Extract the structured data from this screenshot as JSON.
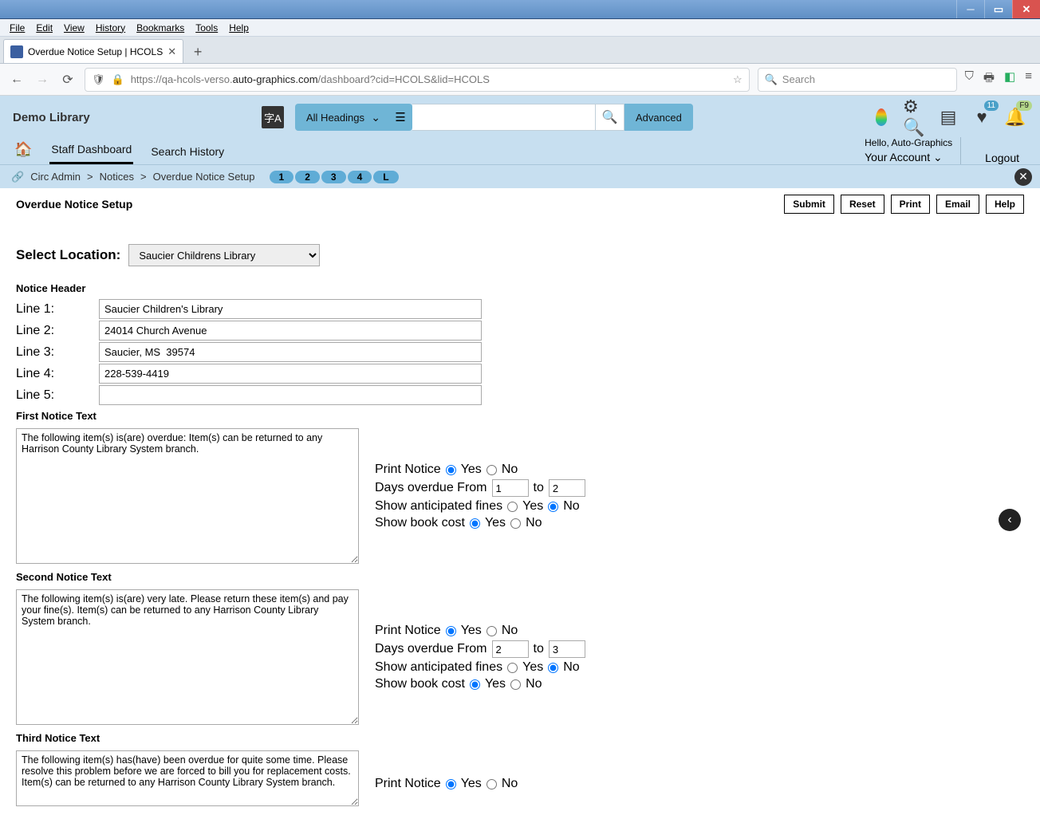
{
  "browser_menu": [
    "File",
    "Edit",
    "View",
    "History",
    "Bookmarks",
    "Tools",
    "Help"
  ],
  "tab_title": "Overdue Notice Setup | HCOLS",
  "url": {
    "prefix": "https://qa-hcols-verso.",
    "domain": "auto-graphics.com",
    "suffix": "/dashboard?cid=HCOLS&lid=HCOLS"
  },
  "search_placeholder": "Search",
  "app": {
    "library_name": "Demo Library",
    "headings_label": "All Headings",
    "advanced_label": "Advanced",
    "badge_heart": "11",
    "badge_bell": "F9",
    "greeting": "Hello, Auto-Graphics",
    "your_account": "Your Account",
    "logout": "Logout",
    "nav": {
      "dashboard": "Staff Dashboard",
      "history": "Search History"
    }
  },
  "breadcrumb": {
    "parts": [
      "Circ Admin",
      "Notices",
      "Overdue Notice Setup"
    ],
    "steps": [
      "1",
      "2",
      "3",
      "4",
      "L"
    ]
  },
  "page": {
    "title": "Overdue Notice Setup",
    "buttons": {
      "submit": "Submit",
      "reset": "Reset",
      "print": "Print",
      "email": "Email",
      "help": "Help"
    }
  },
  "location": {
    "label": "Select Location:",
    "value": "Saucier Childrens Library"
  },
  "header_section": {
    "title": "Notice Header",
    "lines": {
      "l1_label": "Line 1:",
      "l1_val": "Saucier Children's Library",
      "l2_label": "Line 2:",
      "l2_val": "24014 Church Avenue",
      "l3_label": "Line 3:",
      "l3_val": "Saucier, MS  39574",
      "l4_label": "Line 4:",
      "l4_val": "228-539-4419",
      "l5_label": "Line 5:",
      "l5_val": ""
    }
  },
  "notices": {
    "first": {
      "title": "First Notice Text",
      "text": "The following item(s) is(are) overdue: Item(s) can be returned to any Harrison County Library System branch.",
      "print_notice": "Yes",
      "days_from": "1",
      "days_to": "2",
      "fines": "No",
      "cost": "Yes"
    },
    "second": {
      "title": "Second Notice Text",
      "text": "The following item(s) is(are) very late. Please return these item(s) and pay your fine(s). Item(s) can be returned to any Harrison County Library System branch.",
      "print_notice": "Yes",
      "days_from": "2",
      "days_to": "3",
      "fines": "No",
      "cost": "Yes"
    },
    "third": {
      "title": "Third Notice Text",
      "text": "The following item(s) has(have) been overdue for quite some time. Please resolve this problem before we are forced to bill you for replacement costs. Item(s) can be returned to any Harrison County Library System branch.",
      "print_notice": "Yes"
    }
  },
  "labels": {
    "print_notice": "Print Notice",
    "yes": "Yes",
    "no": "No",
    "days_from": "Days overdue From",
    "to": "to",
    "fines": "Show anticipated fines",
    "cost": "Show book cost"
  }
}
